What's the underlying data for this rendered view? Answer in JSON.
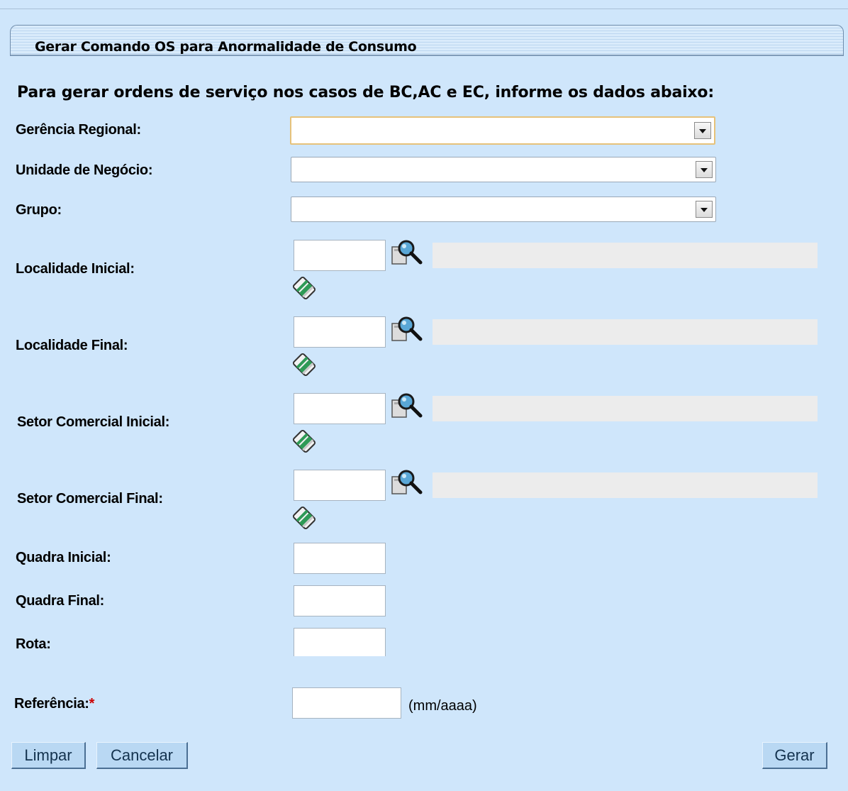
{
  "window": {
    "title": "Gerar Comando OS para Anormalidade de Consumo"
  },
  "form": {
    "instruction": "Para gerar ordens de serviço nos casos de BC,AC e EC, informe os dados abaixo:",
    "gerencia_regional": {
      "label": "Gerência Regional:",
      "value": ""
    },
    "unidade_negocio": {
      "label": "Unidade de Negócio:",
      "value": ""
    },
    "grupo": {
      "label": "Grupo:",
      "value": ""
    },
    "localidade_inicial": {
      "label": "Localidade Inicial:",
      "code": "",
      "description": ""
    },
    "localidade_final": {
      "label": "Localidade Final:",
      "code": "",
      "description": ""
    },
    "setor_comercial_inicial": {
      "label": "Setor Comercial Inicial:",
      "code": "",
      "description": ""
    },
    "setor_comercial_final": {
      "label": "Setor Comercial Final:",
      "code": "",
      "description": ""
    },
    "quadra_inicial": {
      "label": "Quadra Inicial:",
      "value": ""
    },
    "quadra_final": {
      "label": "Quadra Final:",
      "value": ""
    },
    "rota": {
      "label": "Rota:",
      "value": ""
    },
    "referencia": {
      "label": "Referência:",
      "required_mark": "*",
      "value": "",
      "format_hint": "(mm/aaaa)"
    }
  },
  "buttons": {
    "limpar": "Limpar",
    "cancelar": "Cancelar",
    "gerar": "Gerar"
  },
  "icons": {
    "search": "magnifier-search-icon",
    "clear": "eraser-icon"
  },
  "colors": {
    "background": "#cfe6fb",
    "button": "#b9d8f3",
    "required": "#cc0000"
  }
}
